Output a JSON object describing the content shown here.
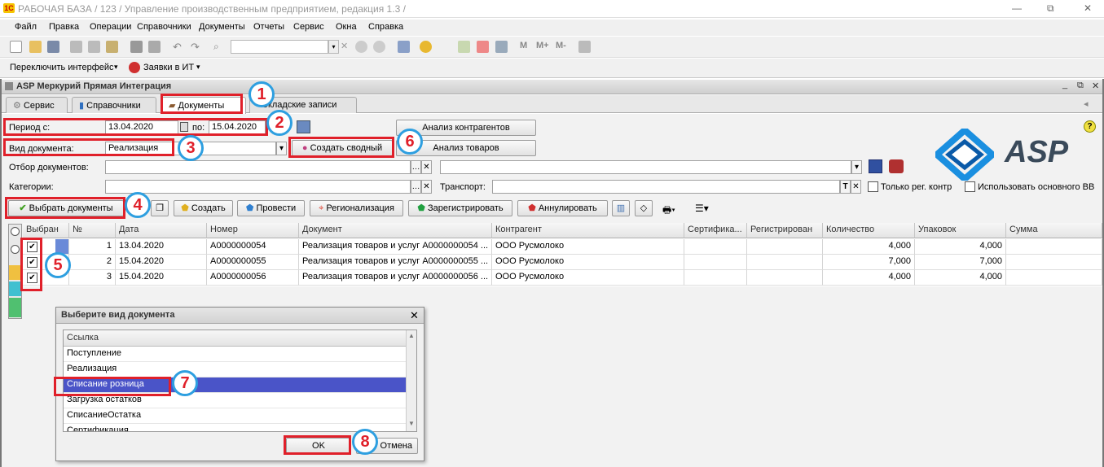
{
  "window": {
    "title": "РАБОЧАЯ БАЗА / 123 / Управление производственным предприятием, редакция 1.3 /",
    "logo": "1C",
    "min": "—",
    "max": "⧉",
    "close": "✕"
  },
  "menu": [
    "Файл",
    "Правка",
    "Операции",
    "Справочники",
    "Документы",
    "Отчеты",
    "Сервис",
    "Окна",
    "Справка"
  ],
  "toolbar2": {
    "switch_label": "Переключить интерфейс",
    "requests_label": "Заявки в ИТ"
  },
  "form": {
    "title": "ASP Меркурий Прямая Интеграция",
    "restore": "⧉",
    "close": "✕"
  },
  "tabs": [
    "Сервис",
    "Справочники",
    "Документы",
    "Складские записи"
  ],
  "filters": {
    "period_label": "Период с:",
    "period_from": "13.04.2020",
    "period_to_label": "по:",
    "period_to": "15.04.2020",
    "doctype_label": "Вид документа:",
    "doctype_value": "Реализация",
    "docfilter_label": "Отбор документов:",
    "categories_label": "Категории:",
    "transport_label": "Транспорт:",
    "only_reg_label": "Только рег. контр",
    "use_main_label": "Использовать основного ВВ"
  },
  "buttons": {
    "analyze_counterparties": "Анализ контрагентов",
    "analyze_goods": "Анализ товаров",
    "create_summary": "Создать сводный",
    "select_docs": "Выбрать документы",
    "create": "Создать",
    "post": "Провести",
    "regionalize": "Регионализация",
    "register": "Зарегистрировать",
    "annul": "Аннулировать"
  },
  "logo": {
    "text": "ASP"
  },
  "grid": {
    "columns": [
      "Выбран",
      "№",
      "Дата",
      "Номер",
      "Документ",
      "Контрагент",
      "Сертифика...",
      "Регистрирован",
      "Количество",
      "Упаковок",
      "Сумма"
    ],
    "rows": [
      {
        "selected": "✔",
        "n": "1",
        "date": "13.04.2020",
        "number": "А0000000054",
        "doc": "Реализация товаров и услуг А0000000054 ...",
        "counterparty": "ООО Русмолоко",
        "cert": "",
        "reg": "",
        "qty": "4,000",
        "packs": "4,000",
        "sum": ""
      },
      {
        "selected": "✔",
        "n": "2",
        "date": "15.04.2020",
        "number": "А0000000055",
        "doc": "Реализация товаров и услуг А0000000055 ...",
        "counterparty": "ООО Русмолоко",
        "cert": "",
        "reg": "",
        "qty": "7,000",
        "packs": "7,000",
        "sum": ""
      },
      {
        "selected": "✔",
        "n": "3",
        "date": "15.04.2020",
        "number": "А0000000056",
        "doc": "Реализация товаров и услуг А0000000056 ...",
        "counterparty": "ООО Русмолоко",
        "cert": "",
        "reg": "",
        "qty": "4,000",
        "packs": "4,000",
        "sum": ""
      }
    ]
  },
  "dialog": {
    "title": "Выберите вид документа",
    "column": "Ссылка",
    "items": [
      "Поступление",
      "Реализация",
      "Списание розница",
      "Загрузка остатков",
      "СписаниеОстатка",
      "Сертификация"
    ],
    "selected_index": 2,
    "ok": "OK",
    "cancel": "Отмена"
  },
  "annotations": [
    "1",
    "2",
    "3",
    "4",
    "5",
    "6",
    "7",
    "8"
  ]
}
